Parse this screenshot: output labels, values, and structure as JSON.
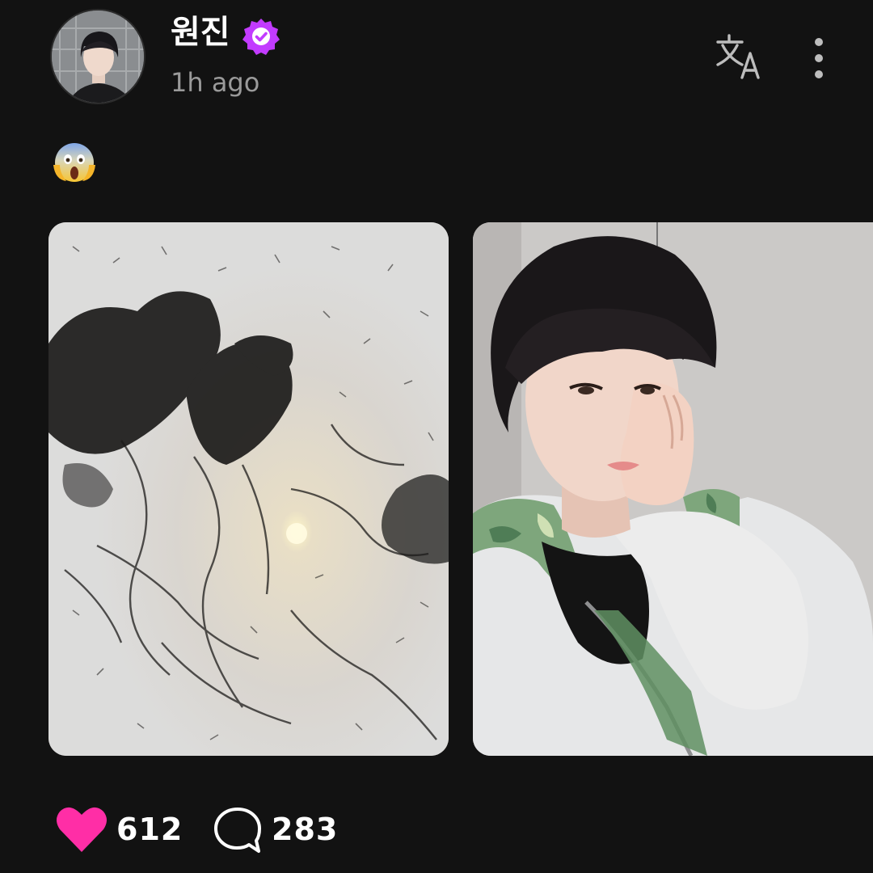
{
  "post": {
    "author": {
      "name": "원진",
      "verified": true,
      "badge_color": "#c23bff"
    },
    "timestamp": "1h ago",
    "text": "😱",
    "photos": [
      {
        "subject": "cut hair clippings on a white surface"
      },
      {
        "subject": "selfie of the author resting cheek on hand, grey hoodie with green camo hood"
      }
    ],
    "likes": {
      "icon": "heart-icon",
      "count": "612",
      "color": "#ff2ea6"
    },
    "comments": {
      "icon": "comment-icon",
      "count": "283"
    }
  },
  "header": {
    "translate_icon": "translate-icon",
    "more_icon": "more-vertical-icon"
  },
  "theme": {
    "background": "#121212",
    "text_primary": "#ffffff",
    "text_secondary": "#9a9a9a"
  }
}
